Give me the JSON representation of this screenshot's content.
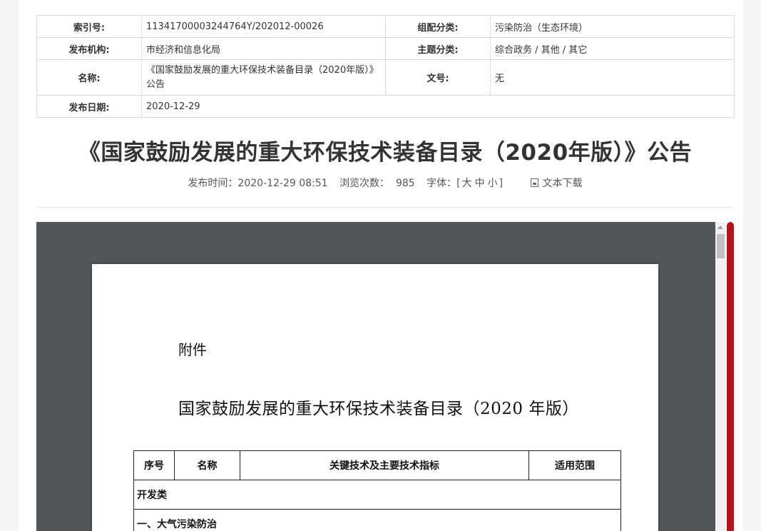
{
  "meta": {
    "index_label": "索引号:",
    "index_value": "11341700003244764Y/202012-00026",
    "group_label": "组配分类:",
    "group_value": "污染防治（生态环境）",
    "publisher_label": "发布机构:",
    "publisher_value": "市经济和信息化局",
    "topic_label": "主题分类:",
    "topic_value": "综合政务 / 其他 / 其它",
    "name_label": "名称:",
    "name_value": "《国家鼓励发展的重大环保技术装备目录（2020年版）》公告",
    "docno_label": "文号:",
    "docno_value": "无",
    "date_label": "发布日期:",
    "date_value": "2020-12-29"
  },
  "article": {
    "title": "《国家鼓励发展的重大环保技术装备目录（2020年版）》公告",
    "publish_time": "发布时间：2020-12-29 08:51",
    "views_label": "浏览次数：",
    "views_count": "985",
    "font_label": "字体：[",
    "font_large": "大",
    "font_medium": "中",
    "font_small": "小",
    "font_close": "]",
    "download_label": "文本下载"
  },
  "pdf": {
    "annex": "附件",
    "title": "国家鼓励发展的重大环保技术装备目录（2020 年版）",
    "table": {
      "headers": [
        "序号",
        "名称",
        "关键技术及主要技术指标",
        "适用范围"
      ],
      "rows": [
        "开发类",
        "一、大气污染防治"
      ]
    }
  },
  "colors": {
    "accent_bar": "#b3141b",
    "viewer_bg": "#525659"
  }
}
